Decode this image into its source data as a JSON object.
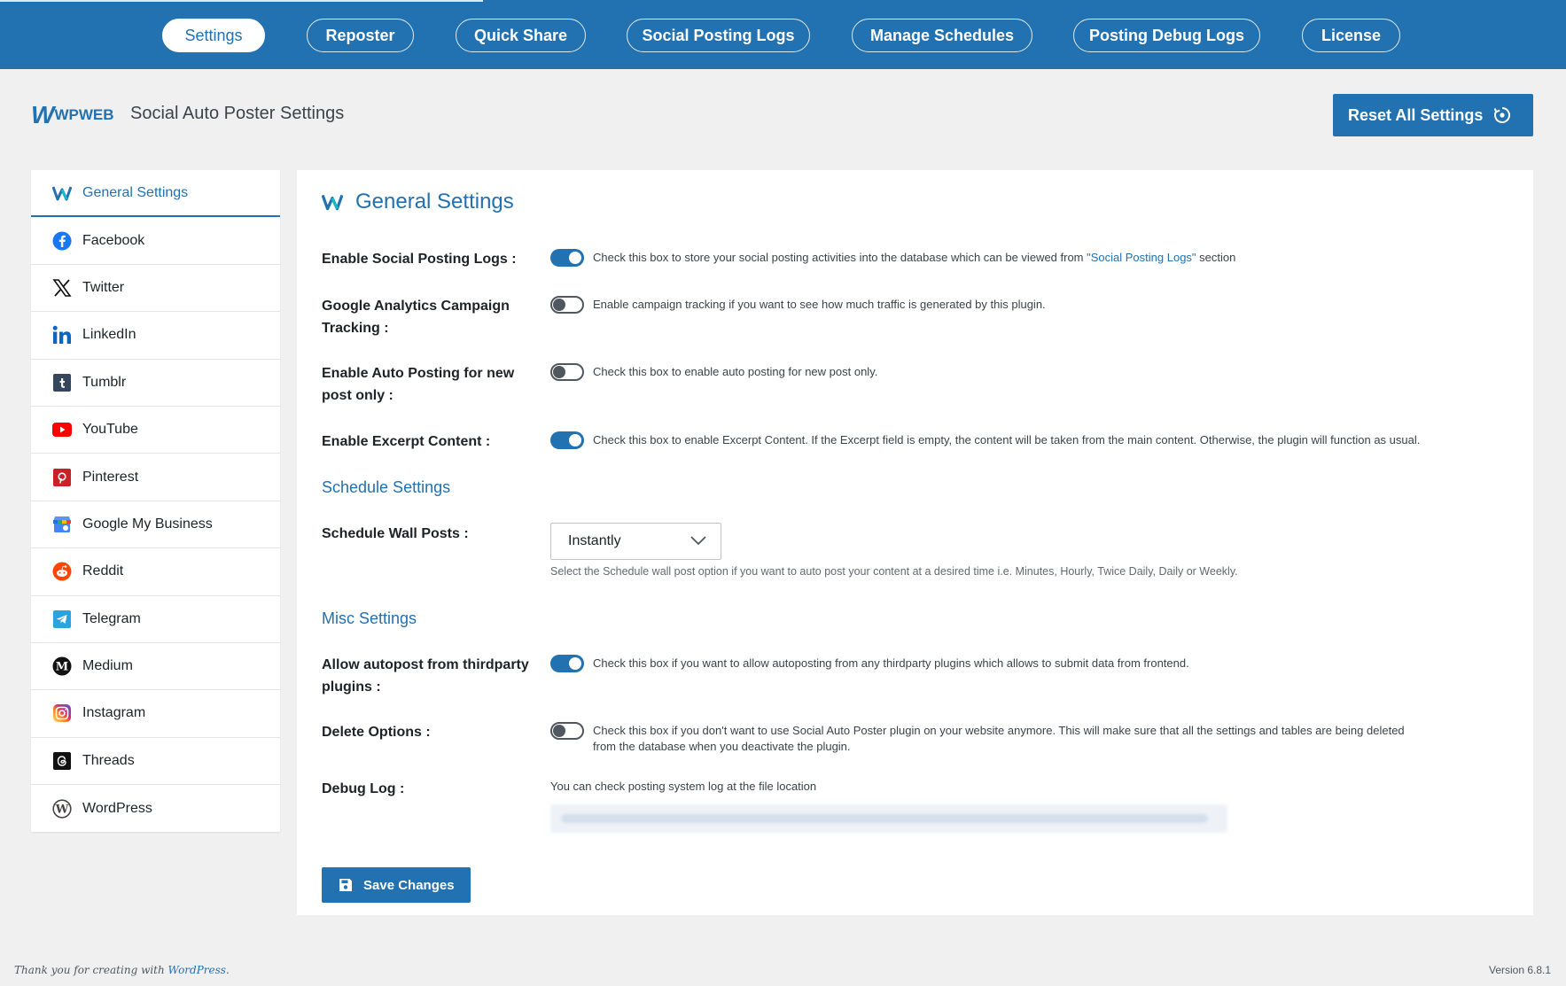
{
  "nav": {
    "tabs": [
      {
        "label": "Settings",
        "active": true
      },
      {
        "label": "Reposter"
      },
      {
        "label": "Quick Share"
      },
      {
        "label": "Social Posting Logs"
      },
      {
        "label": "Manage Schedules"
      },
      {
        "label": "Posting Debug Logs"
      },
      {
        "label": "License"
      }
    ]
  },
  "header": {
    "logo_text": "WPWEB",
    "title": "Social Auto Poster Settings",
    "reset_label": "Reset All Settings"
  },
  "sidebar": {
    "items": [
      {
        "label": "General Settings",
        "icon": "wpweb-icon",
        "active": true
      },
      {
        "label": "Facebook",
        "icon": "facebook-icon"
      },
      {
        "label": "Twitter",
        "icon": "x-twitter-icon"
      },
      {
        "label": "LinkedIn",
        "icon": "linkedin-icon"
      },
      {
        "label": "Tumblr",
        "icon": "tumblr-icon"
      },
      {
        "label": "YouTube",
        "icon": "youtube-icon"
      },
      {
        "label": "Pinterest",
        "icon": "pinterest-icon"
      },
      {
        "label": "Google My Business",
        "icon": "google-my-business-icon"
      },
      {
        "label": "Reddit",
        "icon": "reddit-icon"
      },
      {
        "label": "Telegram",
        "icon": "telegram-icon"
      },
      {
        "label": "Medium",
        "icon": "medium-icon"
      },
      {
        "label": "Instagram",
        "icon": "instagram-icon"
      },
      {
        "label": "Threads",
        "icon": "threads-icon"
      },
      {
        "label": "WordPress",
        "icon": "wordpress-icon"
      }
    ]
  },
  "main": {
    "title": "General Settings",
    "settings": {
      "social_logs": {
        "label": "Enable Social Posting Logs :",
        "enabled": true,
        "desc_before": "Check this box to store your social posting activities into the database which can be viewed from ",
        "desc_link": "\"Social Posting Logs\"",
        "desc_after": " section"
      },
      "ga_tracking": {
        "label_line1": "Google Analytics Campaign",
        "label_line2": "Tracking :",
        "enabled": false,
        "desc": "Enable campaign tracking if you want to see how much traffic is generated by this plugin."
      },
      "auto_new_post": {
        "label_line1": "Enable Auto Posting for new",
        "label_line2": "post only :",
        "enabled": false,
        "desc": "Check this box to enable auto posting for new post only."
      },
      "excerpt": {
        "label": "Enable Excerpt Content :",
        "enabled": true,
        "desc": "Check this box to enable Excerpt Content. If the Excerpt field is empty, the content will be taken from the main content. Otherwise, the plugin will function as usual."
      }
    },
    "schedule": {
      "heading": "Schedule Settings",
      "label": "Schedule Wall Posts :",
      "selected": "Instantly",
      "note": "Select the Schedule wall post option if you want to auto post your content at a desired time i.e. Minutes, Hourly, Twice Daily, Daily or Weekly."
    },
    "misc": {
      "heading": "Misc Settings",
      "thirdparty": {
        "label_line1": "Allow autopost from thirdparty",
        "label_line2": "plugins :",
        "enabled": true,
        "desc": "Check this box if you want to allow autoposting from any thirdparty plugins which allows to submit data from frontend."
      },
      "delete": {
        "label": "Delete Options :",
        "enabled": false,
        "desc_line1": "Check this box if you don't want to use Social Auto Poster plugin on your website anymore. This will make sure that all the settings and tables are being deleted",
        "desc_line2": "from the database when you deactivate the plugin."
      },
      "debug": {
        "label": "Debug Log :",
        "desc": "You can check posting system log at the file location"
      }
    },
    "save_label": "Save Changes"
  },
  "footer": {
    "thanks_before": "Thank you for creating with ",
    "thanks_link": "WordPress",
    "thanks_after": ".",
    "version": "Version 6.8.1"
  },
  "colors": {
    "accent": "#2271b1",
    "nav_bg": "#2271b1",
    "page_bg": "#f0f0f1"
  }
}
